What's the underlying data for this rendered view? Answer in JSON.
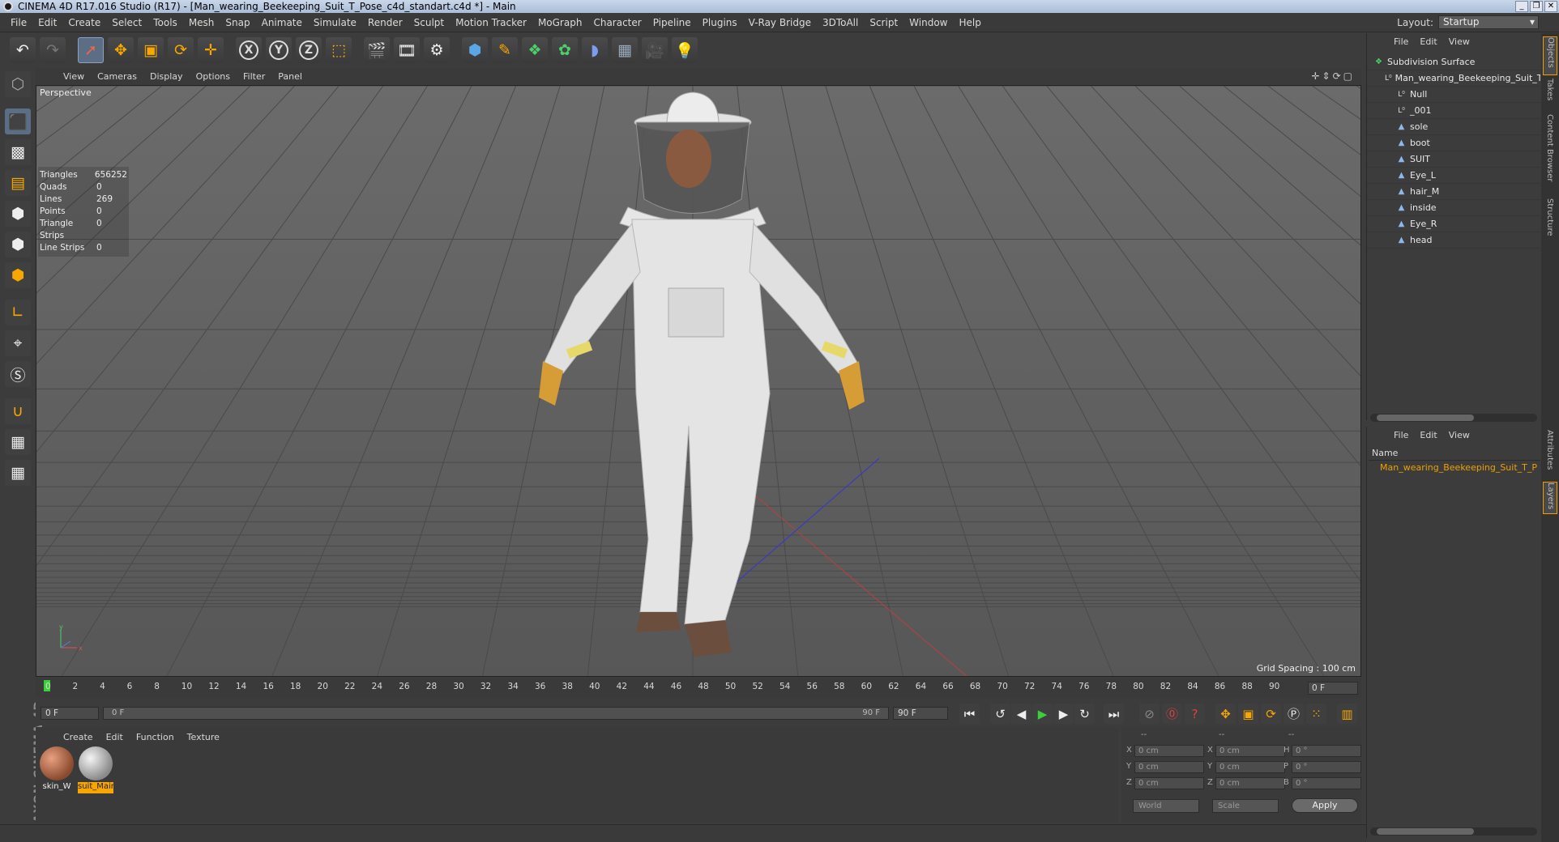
{
  "window": {
    "title": "CINEMA 4D R17.016 Studio (R17) - [Man_wearing_Beekeeping_Suit_T_Pose_c4d_standart.c4d *] - Main",
    "controls": [
      "_",
      "❐",
      "✕"
    ]
  },
  "menubar": {
    "items": [
      "File",
      "Edit",
      "Create",
      "Select",
      "Tools",
      "Mesh",
      "Snap",
      "Animate",
      "Simulate",
      "Render",
      "Sculpt",
      "Motion Tracker",
      "MoGraph",
      "Character",
      "Pipeline",
      "Plugins",
      "V-Ray Bridge",
      "3DToAll",
      "Script",
      "Window",
      "Help"
    ],
    "layout_label": "Layout:",
    "layout_value": "Startup"
  },
  "toolbar": {
    "icons": [
      "undo-icon",
      "redo-icon",
      "live-selection-icon",
      "move-icon",
      "scale-icon",
      "rotate-icon",
      "recent-tool-icon",
      "x-axis-lock-icon",
      "y-axis-lock-icon",
      "z-axis-lock-icon",
      "coordinate-system-icon",
      "render-view-icon",
      "render-picture-viewer-icon",
      "render-settings-icon",
      "cube-icon",
      "pen-spline-icon",
      "subdivision-icon",
      "cloner-icon",
      "deformer-icon",
      "floor-icon",
      "camera-icon",
      "light-icon"
    ],
    "axis_labels": [
      "X",
      "Y",
      "Z"
    ]
  },
  "viewport": {
    "menu": [
      "View",
      "Cameras",
      "Display",
      "Options",
      "Filter",
      "Panel"
    ],
    "label": "Perspective",
    "stats": [
      {
        "k": "Triangles",
        "v": "656252"
      },
      {
        "k": "Quads",
        "v": "0"
      },
      {
        "k": "Lines",
        "v": "269"
      },
      {
        "k": "Points",
        "v": "0"
      },
      {
        "k": "Triangle Strips",
        "v": "0"
      },
      {
        "k": "Line Strips",
        "v": "0"
      }
    ],
    "grid_spacing": "Grid Spacing : 100 cm",
    "axis_y": "y",
    "axis_x": "x"
  },
  "timeline": {
    "ticks": [
      "0",
      "2",
      "4",
      "6",
      "8",
      "10",
      "12",
      "14",
      "16",
      "18",
      "20",
      "22",
      "24",
      "26",
      "28",
      "30",
      "32",
      "34",
      "36",
      "38",
      "40",
      "42",
      "44",
      "46",
      "48",
      "50",
      "52",
      "54",
      "56",
      "58",
      "60",
      "62",
      "64",
      "66",
      "68",
      "70",
      "72",
      "74",
      "76",
      "78",
      "80",
      "82",
      "84",
      "86",
      "88",
      "90"
    ],
    "current_frame": "0 F"
  },
  "transport": {
    "start_field": "0 F",
    "slider_start": "0 F",
    "slider_end": "90 F",
    "end_field": "90 F"
  },
  "materials": {
    "menu": [
      "Create",
      "Edit",
      "Function",
      "Texture"
    ],
    "items": [
      {
        "name": "skin_W",
        "selected": false,
        "color": "#b46a48"
      },
      {
        "name": "suit_Mair",
        "selected": true,
        "color": "#d8d8d8"
      }
    ]
  },
  "coords": {
    "headers": [
      "--",
      "--",
      "--"
    ],
    "rows": [
      {
        "a": "X",
        "av": "0 cm",
        "b": "X",
        "bv": "0 cm",
        "c": "H",
        "cv": "0 °"
      },
      {
        "a": "Y",
        "av": "0 cm",
        "b": "Y",
        "bv": "0 cm",
        "c": "P",
        "cv": "0 °"
      },
      {
        "a": "Z",
        "av": "0 cm",
        "b": "Z",
        "bv": "0 cm",
        "c": "B",
        "cv": "0 °"
      }
    ],
    "world": "World",
    "scale": "Scale",
    "apply": "Apply"
  },
  "objects": {
    "menu": [
      "File",
      "Edit",
      "View"
    ],
    "items": [
      {
        "label": "Subdivision Surface",
        "depth": 0,
        "icon": "subdivision-icon"
      },
      {
        "label": "Man_wearing_Beekeeping_Suit_T_",
        "depth": 1,
        "icon": "null-icon"
      },
      {
        "label": "Null",
        "depth": 2,
        "icon": "null-icon"
      },
      {
        "label": "_001",
        "depth": 2,
        "icon": "null-icon"
      },
      {
        "label": "sole",
        "depth": 2,
        "icon": "polygon-icon"
      },
      {
        "label": "boot",
        "depth": 2,
        "icon": "polygon-icon"
      },
      {
        "label": "SUIT",
        "depth": 2,
        "icon": "polygon-icon"
      },
      {
        "label": "Eye_L",
        "depth": 2,
        "icon": "polygon-icon"
      },
      {
        "label": "hair_M",
        "depth": 2,
        "icon": "polygon-icon"
      },
      {
        "label": "inside",
        "depth": 2,
        "icon": "polygon-icon"
      },
      {
        "label": "Eye_R",
        "depth": 2,
        "icon": "polygon-icon"
      },
      {
        "label": "head",
        "depth": 2,
        "icon": "polygon-icon"
      }
    ]
  },
  "layers": {
    "menu": [
      "File",
      "Edit",
      "View"
    ],
    "header": "Name",
    "row": "Man_wearing_Beekeeping_Suit_T_P"
  },
  "right_tabs": [
    "Objects",
    "Takes",
    "Content Browser",
    "Structure",
    "Attributes",
    "Layers"
  ],
  "colors": {
    "accent": "#f7a700",
    "active_tool": "#5c6d86",
    "bg": "#3c3c3c"
  }
}
